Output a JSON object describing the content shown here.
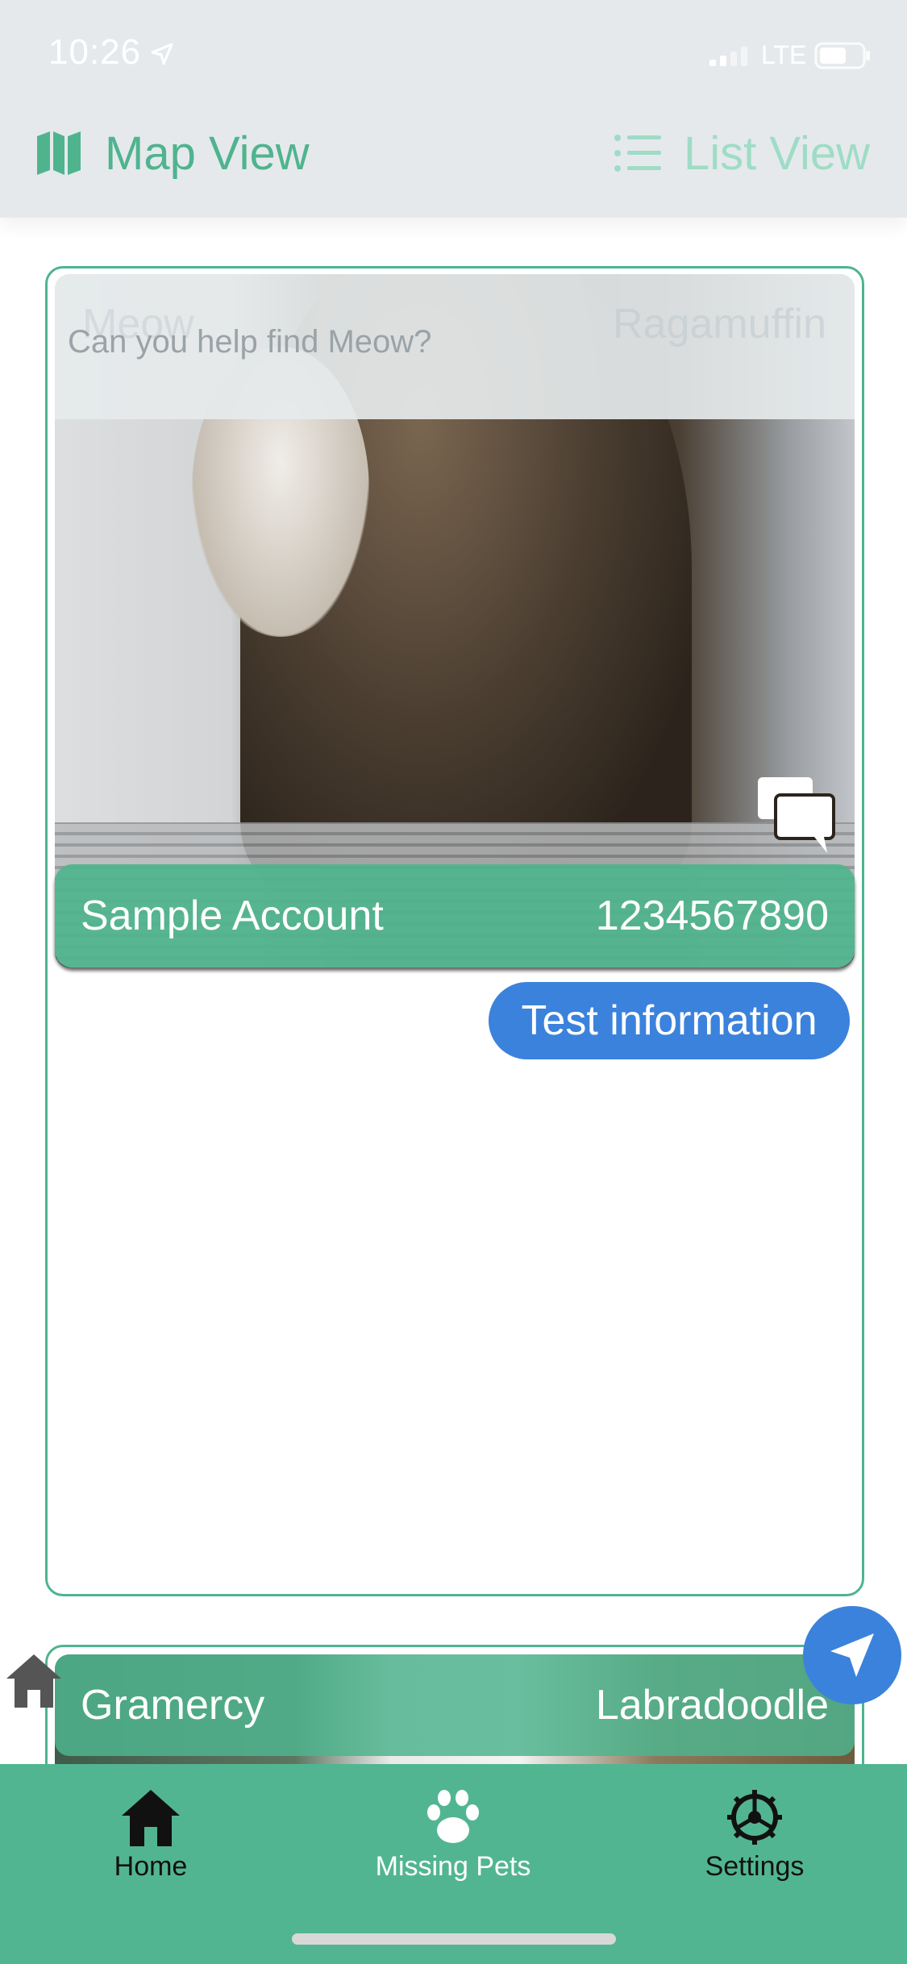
{
  "status_bar": {
    "time": "10:26",
    "network": "LTE",
    "icons": [
      "location-arrow-icon",
      "signal-icon",
      "battery-icon"
    ]
  },
  "header": {
    "map_view_label": "Map View",
    "list_view_label": "List View",
    "map_view_icon": "map-icon",
    "list_view_icon": "list-icon"
  },
  "cards": [
    {
      "name": "Meow",
      "breed": "Ragamuffin",
      "help_text": "Can you help find Meow?",
      "owner": "Sample Account",
      "phone": "1234567890",
      "info": "Test information",
      "chat_icon": "chat-bubbles-icon"
    },
    {
      "name": "Gramercy",
      "breed": "Labradoodle"
    }
  ],
  "tabs": [
    {
      "label": "Home",
      "icon": "home-icon"
    },
    {
      "label": "Missing Pets",
      "icon": "paw-icon"
    },
    {
      "label": "Settings",
      "icon": "gear-icon"
    }
  ],
  "colors": {
    "accent_green": "#52b592",
    "blue": "#3b82dc",
    "header_bg": "#e6e9ec"
  }
}
